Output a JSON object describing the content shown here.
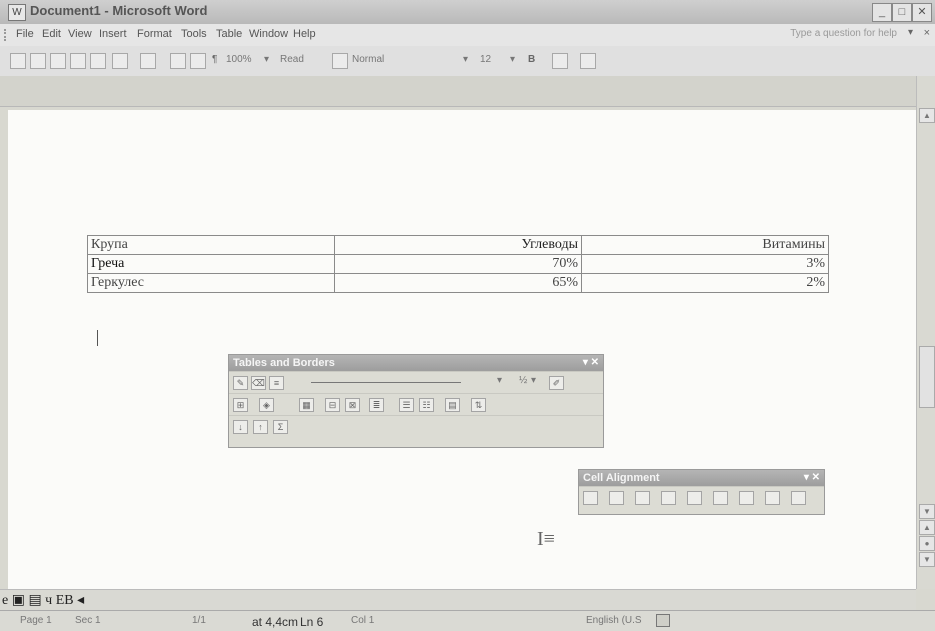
{
  "window": {
    "title": "Document1 - Microsoft Word",
    "app_icon": "word-document-icon"
  },
  "menu": {
    "items": [
      "File",
      "Edit",
      "View",
      "Insert",
      "Format",
      "Tools",
      "Table",
      "Window",
      "Help"
    ],
    "ask_box": "Type a question for help",
    "close_doc": "×"
  },
  "toolbar": {
    "zoom": "100%",
    "read": "Read",
    "style": "Normal",
    "font_size": "12",
    "bold": "B"
  },
  "table": {
    "rows": [
      [
        "Крупа",
        "Углеводы",
        "Витамины"
      ],
      [
        "Греча",
        "70%",
        "3%"
      ],
      [
        "Геркулес",
        "65%",
        "2%"
      ]
    ]
  },
  "tables_and_borders": {
    "title": "Tables and Borders",
    "line_weight": "½",
    "sort_hint": "Σ"
  },
  "cell_alignment": {
    "title": "Cell Alignment"
  },
  "viewbar": {
    "text": "е ▣ ▤ ч ЕВ ◂"
  },
  "status": {
    "page": "Page 1",
    "sec": "Sec 1",
    "pages": "1/1",
    "at": "at 4,4cm",
    "ln": "Ln 6",
    "col": "Col 1",
    "lang": "English (U.S"
  }
}
